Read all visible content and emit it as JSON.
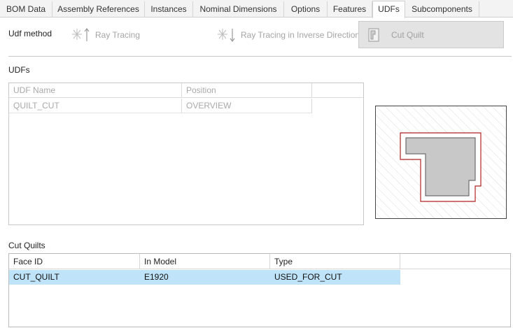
{
  "tabs": [
    {
      "label": "BOM Data",
      "active": false
    },
    {
      "label": "Assembly References",
      "active": false
    },
    {
      "label": "Instances",
      "active": false
    },
    {
      "label": "Nominal Dimensions",
      "active": false
    },
    {
      "label": "Options",
      "active": false
    },
    {
      "label": "Features",
      "active": false
    },
    {
      "label": "UDFs",
      "active": true
    },
    {
      "label": "Subcomponents",
      "active": false
    }
  ],
  "udf_method": {
    "label": "Udf method",
    "options": [
      {
        "label": "Ray Tracing",
        "icon": "ray-tracing-up-icon",
        "enabled": false
      },
      {
        "label": "Ray Tracing in Inverse Direction",
        "icon": "ray-tracing-down-icon",
        "enabled": false
      },
      {
        "label": "Cut Quilt",
        "icon": "cut-quilt-icon",
        "selected": true
      }
    ]
  },
  "udfs": {
    "label": "UDFs",
    "columns": [
      "UDF Name",
      "Position"
    ],
    "rows": [
      {
        "name": "QUILT_CUT",
        "position": "OVERVIEW"
      }
    ]
  },
  "preview": {
    "icon": "cut-quilt-preview-icon",
    "outline_color": "#b22222",
    "fill_color": "#c8c8c8"
  },
  "cut_quilts": {
    "label": "Cut Quilts",
    "columns": [
      "Face ID",
      "In Model",
      "Type"
    ],
    "rows": [
      {
        "face_id": "CUT_QUILT",
        "in_model": "E1920",
        "type": "USED_FOR_CUT",
        "selected": true
      }
    ],
    "selection_color": "#bfe3f8"
  }
}
